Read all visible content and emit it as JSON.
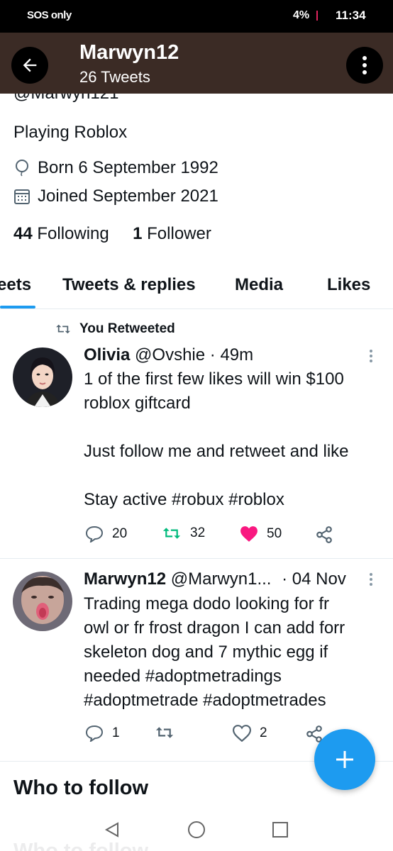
{
  "status_bar": {
    "carrier": "SOS only",
    "battery": "4%",
    "time": "11:34"
  },
  "header": {
    "title": "Marwyn12",
    "subtitle": "26 Tweets"
  },
  "profile": {
    "handle_partial": "@Marwyn121",
    "bio": "Playing Roblox",
    "born": "Born 6 September 1992",
    "joined": "Joined September 2021",
    "following_count": "44",
    "following_label": "Following",
    "followers_count": "1",
    "followers_label": "Follower"
  },
  "tabs": [
    {
      "label": "eets"
    },
    {
      "label": "Tweets & replies"
    },
    {
      "label": "Media"
    },
    {
      "label": "Likes"
    }
  ],
  "tweets": [
    {
      "retweet_label": "You Retweeted",
      "name": "Olivia",
      "handle": "@Ovshie",
      "time": "· 49m",
      "lines": [
        "1 of the first few likes will win $100",
        "roblox giftcard",
        "",
        "Just follow me and retweet and like",
        "",
        "Stay active #robux #roblox"
      ],
      "replies": "20",
      "retweets": "32",
      "likes": "50"
    },
    {
      "name": "Marwyn12",
      "handle": "@Marwyn1...",
      "time": "· 04 Nov",
      "lines": [
        "Trading mega dodo looking for fr",
        "owl or fr frost dragon I can add forr",
        "skeleton dog and 7 mythic egg if",
        "needed #adoptmetradings",
        "#adoptmetrade #adoptmetrades"
      ],
      "replies": "1",
      "retweets": "",
      "likes": "2"
    }
  ],
  "who_to_follow": "Who to follow",
  "colors": {
    "accent": "#1d9bf0",
    "header_bg": "#3b2b25",
    "like": "#f91880",
    "retweet": "#00ba7c"
  }
}
